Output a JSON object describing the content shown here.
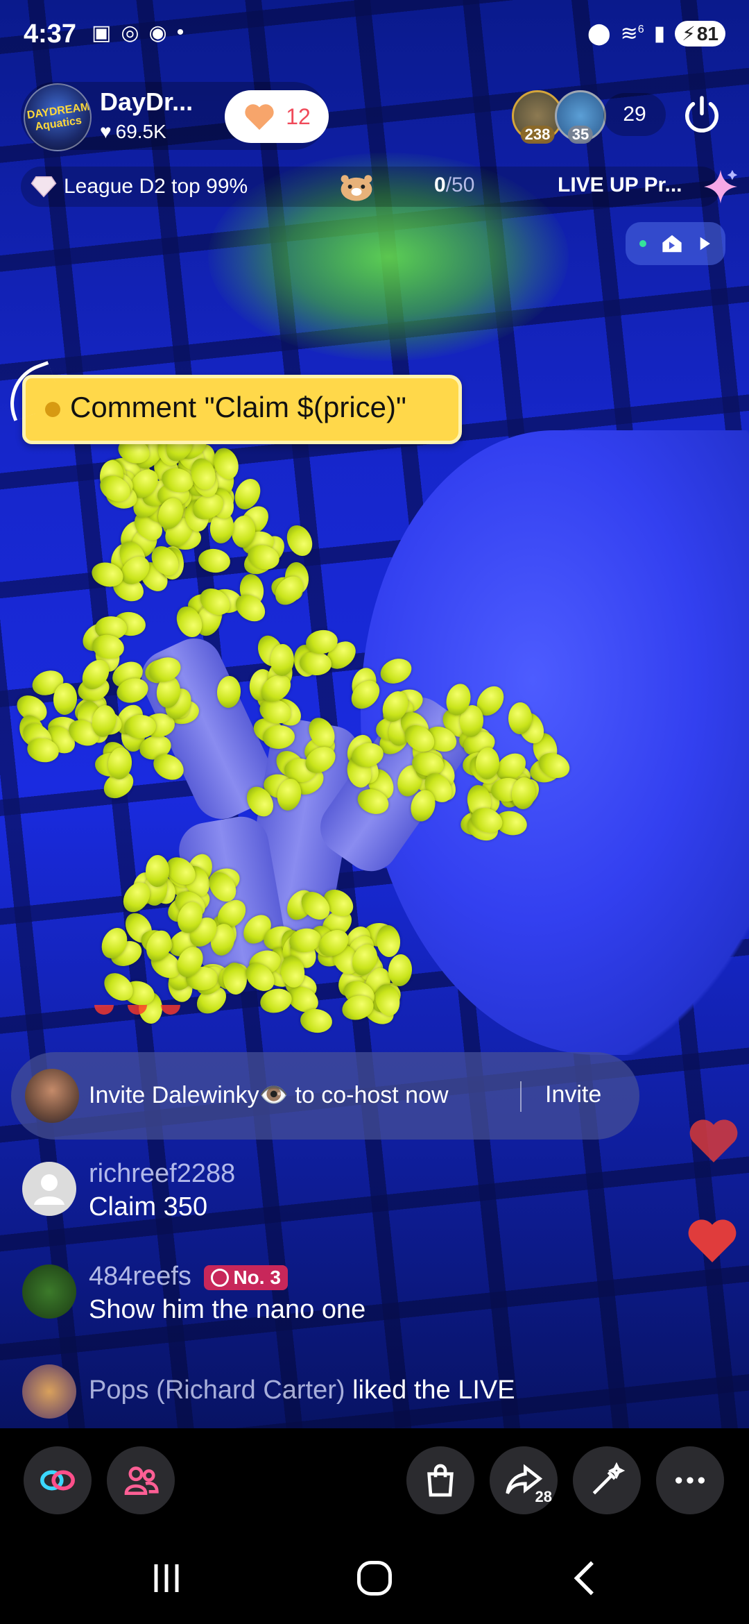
{
  "status_bar": {
    "time": "4:37",
    "battery": "81",
    "signal": "6"
  },
  "host": {
    "name": "DayDr...",
    "likes": "69.5K",
    "logo_text": "DAYDREAM Aquatics",
    "follow_count": "12"
  },
  "viewers": {
    "top": [
      {
        "badge": "238"
      },
      {
        "badge": "35"
      }
    ],
    "count": "29"
  },
  "league": {
    "label": "League D2 top 99%",
    "goal_current": "0",
    "goal_total": "/50",
    "live_up": "LIVE UP Pr..."
  },
  "claim_tag": {
    "text": "Comment \"Claim $(price)\""
  },
  "cohost_invite": {
    "text": "Invite Dalewinky👁️ to co-host now",
    "button": "Invite"
  },
  "comments": [
    {
      "user": "richreef2288",
      "text": "Claim 350"
    },
    {
      "user": "484reefs",
      "badge": "No. 3",
      "text": "Show him the nano one"
    }
  ],
  "liked": {
    "user": "Pops (Richard Carter)",
    "action": " liked the LIVE"
  },
  "toolbar": {
    "share_count": "28"
  },
  "colors": {
    "accent": "#f04a5a",
    "claim_tag": "#ffd84a",
    "rank_badge": "#c8275a",
    "heart": "#e03c3c"
  }
}
